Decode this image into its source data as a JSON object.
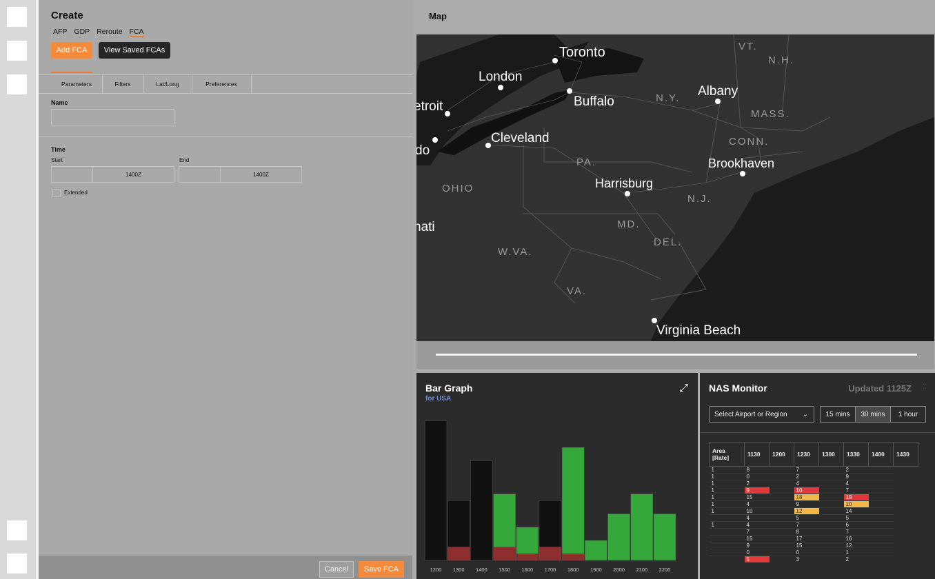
{
  "left": {
    "title": "Create",
    "mode_tabs": [
      "AFP",
      "GDP",
      "Reroute",
      "FCA"
    ],
    "add_button": "Add FCA",
    "view_button": "View Saved FCAs",
    "sub_tabs": [
      "Parameters",
      "Filters",
      "Lat/Long",
      "Preferences"
    ],
    "name_label": "Name",
    "name_value": "",
    "time_label": "Time",
    "start_label": "Start",
    "end_label": "End",
    "start_time": "1400Z",
    "end_time": "1400Z",
    "extended_label": "Extended",
    "cancel": "Cancel",
    "save": "Save FCA"
  },
  "map": {
    "title": "Map",
    "cities": [
      "Toronto",
      "London",
      "Buffalo",
      "Albany",
      "etroit",
      "Cleveland",
      "do",
      "Brookhaven",
      "Harrisburg",
      "nati",
      "Virginia Beach"
    ],
    "states": [
      "VT.",
      "N.H.",
      "N.Y.",
      "MASS.",
      "CONN.",
      "PA.",
      "N.J.",
      "OHIO",
      "MD.",
      "DEL.",
      "W.VA.",
      "VA."
    ]
  },
  "bar_graph": {
    "title": "Bar Graph",
    "subtitle": "for USA",
    "expand_icon": "expand-icon"
  },
  "chart_data": {
    "type": "bar",
    "categories": [
      "1200",
      "1300",
      "1400",
      "1500",
      "1600",
      "1700",
      "1800",
      "1900",
      "2000",
      "2100",
      "2200"
    ],
    "series": [
      {
        "values": [
          0,
          0,
          0,
          2,
          1,
          2,
          1,
          0,
          0,
          0,
          0
        ],
        "color": "#8f2e2e"
      },
      {
        "values": [
          0,
          2,
          0,
          0,
          0,
          0,
          0,
          0,
          0,
          0,
          0
        ],
        "color": "#8f2e2e"
      },
      {
        "values": [
          0,
          0,
          0,
          8,
          4,
          0,
          16,
          3,
          7,
          10,
          7
        ],
        "color": "#34a83a"
      },
      {
        "values": [
          21,
          7,
          15,
          0,
          0,
          7,
          0,
          0,
          0,
          0,
          0
        ],
        "color": "#111"
      }
    ],
    "ylim": [
      0,
      22
    ]
  },
  "nas": {
    "title": "NAS Monitor",
    "updated": "Updated 1125Z",
    "select_placeholder": "Select Airport or Region",
    "segments": [
      "15 mins",
      "30 mins",
      "1 hour"
    ],
    "columns": [
      "Area [Rate]",
      "1130",
      "1200",
      "1230",
      "1300",
      "1330",
      "1400",
      "1430"
    ],
    "rows": [
      [
        "1",
        "8",
        "",
        "7",
        "",
        "2",
        ""
      ],
      [
        "1",
        "0",
        "",
        "2",
        "",
        "9",
        ""
      ],
      [
        "1",
        "2",
        "",
        "4",
        "",
        "4",
        ""
      ],
      [
        "1",
        "9",
        "",
        "10",
        "",
        "7",
        ""
      ],
      [
        "1",
        "15",
        "",
        "18",
        "",
        "19",
        ""
      ],
      [
        "1",
        "4",
        "",
        "9",
        "",
        "10",
        ""
      ],
      [
        "1",
        "10",
        "",
        "12",
        "",
        "14",
        ""
      ],
      [
        "",
        "4",
        "",
        "5",
        "",
        "5",
        ""
      ],
      [
        "1",
        "4",
        "",
        "7",
        "",
        "6",
        ""
      ],
      [
        "",
        "7",
        "",
        "8",
        "",
        "7",
        ""
      ],
      [
        "",
        "15",
        "",
        "17",
        "",
        "16",
        ""
      ],
      [
        "",
        "9",
        "",
        "15",
        "",
        "12",
        ""
      ],
      [
        "",
        "0",
        "",
        "0",
        "",
        "1",
        ""
      ],
      [
        "",
        "5",
        "",
        "3",
        "",
        "2",
        ""
      ]
    ]
  }
}
